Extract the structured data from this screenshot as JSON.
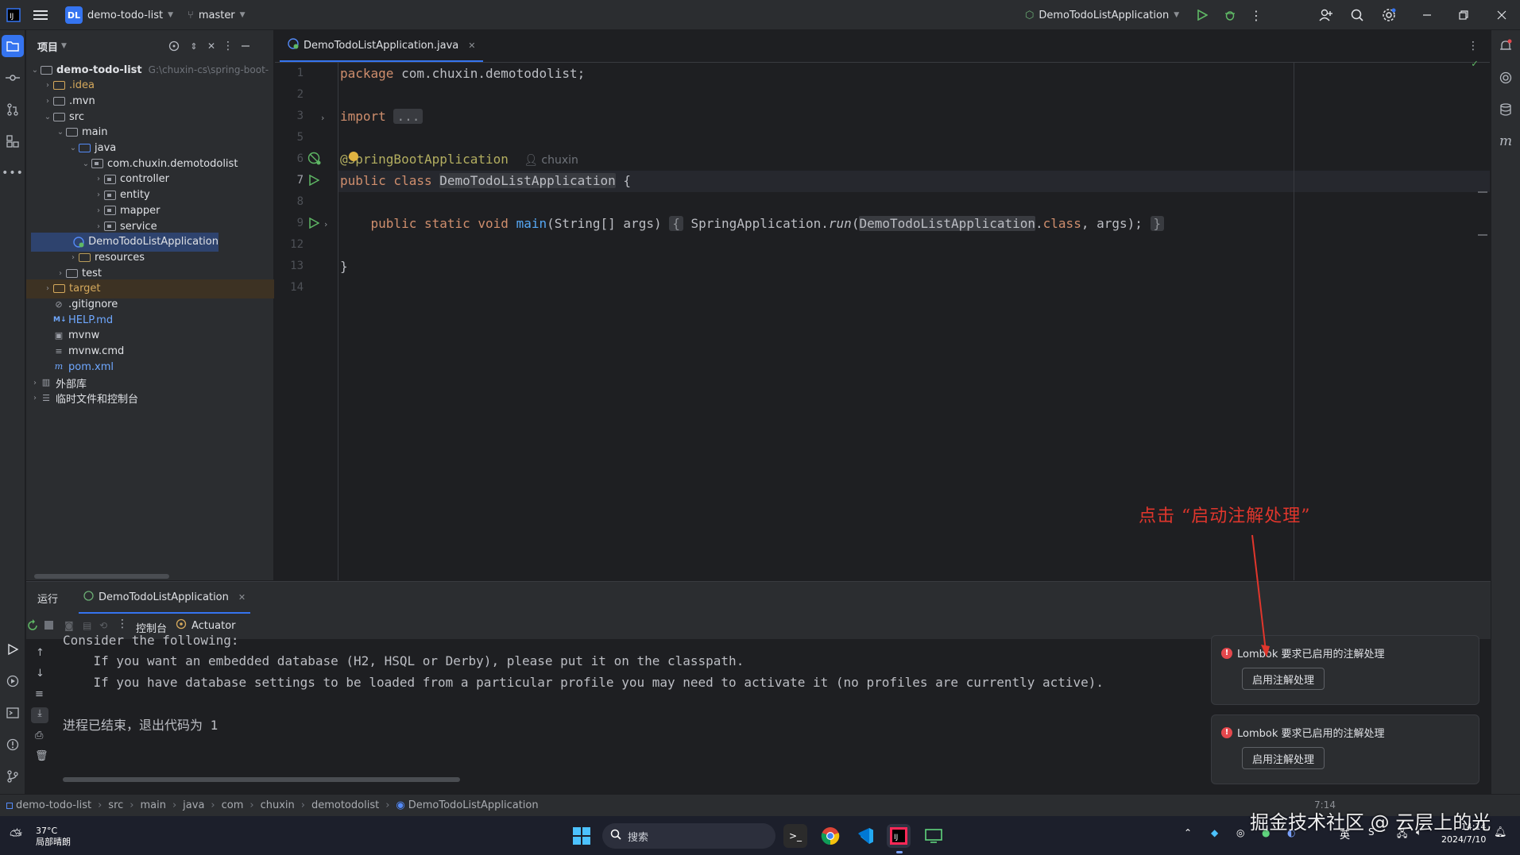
{
  "titlebar": {
    "project_badge": "DL",
    "project_name": "demo-todo-list",
    "branch": "master",
    "run_config": "DemoTodoListApplication"
  },
  "project_panel": {
    "title": "项目",
    "tree": [
      {
        "label": "demo-todo-list",
        "path": "G:\\chuxin-cs\\spring-boot-",
        "depth": 0,
        "icon": "folder-icon",
        "expanded": true,
        "bold": true
      },
      {
        "label": ".idea",
        "depth": 1,
        "icon": "folder-icon",
        "expanded": false,
        "color": "#d5a95c"
      },
      {
        "label": ".mvn",
        "depth": 1,
        "icon": "folder-icon",
        "expanded": false
      },
      {
        "label": "src",
        "depth": 1,
        "icon": "folder-icon",
        "expanded": true
      },
      {
        "label": "main",
        "depth": 2,
        "icon": "folder-icon",
        "expanded": true
      },
      {
        "label": "java",
        "depth": 3,
        "icon": "source-folder-icon",
        "expanded": true
      },
      {
        "label": "com.chuxin.demotodolist",
        "depth": 4,
        "icon": "package-icon",
        "expanded": true
      },
      {
        "label": "controller",
        "depth": 5,
        "icon": "package-icon",
        "expanded": false
      },
      {
        "label": "entity",
        "depth": 5,
        "icon": "package-icon",
        "expanded": false
      },
      {
        "label": "mapper",
        "depth": 5,
        "icon": "package-icon",
        "expanded": false
      },
      {
        "label": "service",
        "depth": 5,
        "icon": "package-icon",
        "expanded": false
      },
      {
        "label": "DemoTodoListApplication",
        "depth": 5,
        "icon": "spring-class-icon",
        "selected": true,
        "leaf": true
      },
      {
        "label": "resources",
        "depth": 3,
        "icon": "resources-folder-icon",
        "expanded": false
      },
      {
        "label": "test",
        "depth": 2,
        "icon": "folder-icon",
        "expanded": false
      },
      {
        "label": "target",
        "depth": 1,
        "icon": "folder-icon",
        "expanded": false,
        "color": "#d5a95c",
        "highlight": true
      },
      {
        "label": ".gitignore",
        "depth": 1,
        "icon": "ignore-file-icon",
        "leaf": true
      },
      {
        "label": "HELP.md",
        "depth": 1,
        "icon": "markdown-icon",
        "leaf": true,
        "color": "#6fa8ff"
      },
      {
        "label": "mvnw",
        "depth": 1,
        "icon": "terminal-file-icon",
        "leaf": true
      },
      {
        "label": "mvnw.cmd",
        "depth": 1,
        "icon": "text-file-icon",
        "leaf": true
      },
      {
        "label": "pom.xml",
        "depth": 1,
        "icon": "maven-icon",
        "leaf": true,
        "color": "#6fa8ff"
      },
      {
        "label": "外部库",
        "depth": 0,
        "icon": "library-icon",
        "expanded": false
      },
      {
        "label": "临时文件和控制台",
        "depth": 0,
        "icon": "scratch-icon",
        "expanded": false
      }
    ]
  },
  "editor": {
    "tab_label": "DemoTodoListApplication.java",
    "line_numbers": [
      "1",
      "2",
      "3",
      "5",
      "6",
      "7",
      "8",
      "9",
      "12",
      "13",
      "14"
    ],
    "lines": {
      "l1_kw": "package",
      "l1_rest": " com.chuxin.demotodolist;",
      "l3_kw": "import",
      "l3_fold": "...",
      "l6_ann": "@SpringBootApplication",
      "l6_author": "chuxin",
      "l7_kw": "public class",
      "l7_name": "DemoTodoListApplication",
      "l7_rest": " {",
      "l9_kw": "public static void",
      "l9_fn": "main",
      "l9_args": "(String[] args)",
      "l9_open": "{",
      "l9_call": "SpringApplication.",
      "l9_run": "run",
      "l9_cls": "DemoTodoListApplication",
      "l9_dot": ".",
      "l9_class_kw": "class",
      "l9_tail": ", args);",
      "l9_close": "}",
      "l13": "}"
    }
  },
  "run_panel": {
    "title": "运行",
    "tab_label": "DemoTodoListApplication",
    "console_tab": "控制台",
    "actuator_tab": "Actuator",
    "console_lines": [
      "Consider the following:",
      "    If you want an embedded database (H2, HSQL or Derby), please put it on the classpath.",
      "    If you have database settings to be loaded from a particular profile you may need to activate it (no profiles are currently active).",
      "",
      "进程已结束，退出代码为 1"
    ]
  },
  "notifications": [
    {
      "message": "Lombok 要求已启用的注解处理",
      "action": "启用注解处理"
    },
    {
      "message": "Lombok 要求已启用的注解处理",
      "action": "启用注解处理"
    }
  ],
  "annotation_text": "点击 “启动注解处理”",
  "statusbar": {
    "breadcrumbs": [
      "demo-todo-list",
      "src",
      "main",
      "java",
      "com",
      "chuxin",
      "demotodolist",
      "DemoTodoListApplication"
    ],
    "position": "7:14"
  },
  "taskbar": {
    "weather_temp": "37°C",
    "weather_desc": "局部晴朗",
    "search_placeholder": "搜索",
    "ime_lang": "英",
    "time": "14:14",
    "date": "2024/7/10"
  },
  "watermark": "掘金技术社区 @ 云层上的光",
  "colors": {
    "accent": "#3574f0",
    "error": "#e5484d",
    "annotation": "#e0362c"
  }
}
